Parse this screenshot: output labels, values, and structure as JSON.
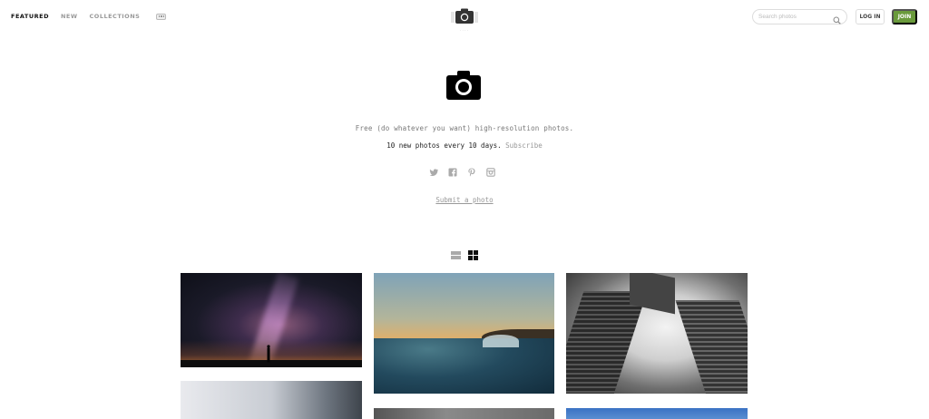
{
  "nav": {
    "items": [
      {
        "label": "FEATURED",
        "active": true
      },
      {
        "label": "NEW",
        "active": false
      },
      {
        "label": "COLLECTIONS",
        "active": false
      }
    ],
    "more_icon": "ellipsis-icon"
  },
  "logo": {
    "icon": "camera-icon"
  },
  "search": {
    "placeholder": "Search photos",
    "icon": "search-icon"
  },
  "auth": {
    "login_label": "LOG IN",
    "join_label": "JOIN"
  },
  "colors": {
    "accent_green": "#6a9a3c",
    "text_dark": "#222222",
    "text_muted": "#999999"
  },
  "hero": {
    "icon": "camera-icon",
    "tagline": "Free (do whatever you want) high-resolution photos.",
    "sub_prefix": "10 new photos every 10 days.",
    "subscribe_label": "Subscribe",
    "social_icons": [
      "twitter-icon",
      "facebook-icon",
      "pinterest-icon",
      "instagram-icon"
    ],
    "submit_label": "Submit a photo"
  },
  "view_toggle": {
    "icons": [
      "list-view-icon",
      "grid-view-icon"
    ],
    "active": "grid-view-icon"
  },
  "photos": [
    {
      "subject": "milky-way-night-sky"
    },
    {
      "subject": "ocean-wave-sunset"
    },
    {
      "subject": "skyscrapers-looking-up"
    },
    {
      "subject": "city-street-blur"
    },
    {
      "subject": "cloudy-landscape"
    },
    {
      "subject": "blue-sky"
    }
  ]
}
